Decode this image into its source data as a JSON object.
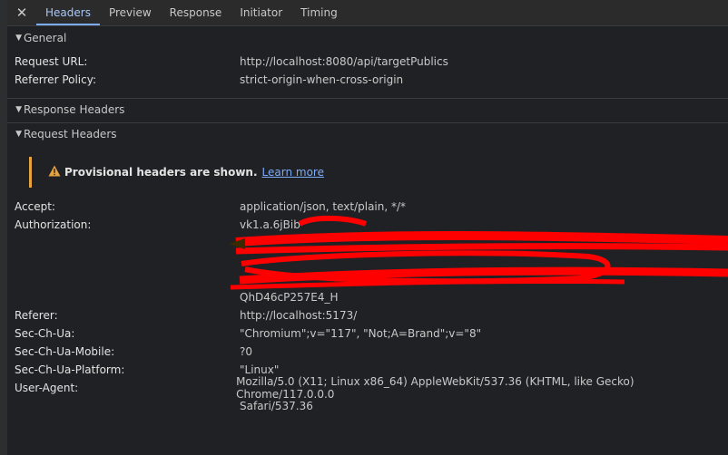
{
  "tabs": [
    "Headers",
    "Preview",
    "Response",
    "Initiator",
    "Timing"
  ],
  "sections": {
    "general": "General",
    "response_headers": "Response Headers",
    "request_headers": "Request Headers"
  },
  "general": {
    "request_url_key": "Request URL:",
    "request_url_val": "http://localhost:8080/api/targetPublics",
    "referrer_policy_key": "Referrer Policy:",
    "referrer_policy_val": "strict-origin-when-cross-origin"
  },
  "warning": {
    "text": "Provisional headers are shown.",
    "link": "Learn more"
  },
  "request": {
    "accept_key": "Accept:",
    "accept_val": "application/json, text/plain, */*",
    "auth_key": "Authorization:",
    "auth_lines": [
      "vk1.a.6jBib",
      "",
      "",
      "",
      "QhD46cP257E4_H"
    ],
    "referer_key": "Referer:",
    "referer_val": "http://localhost:5173/",
    "sec_ch_ua_key": "Sec-Ch-Ua:",
    "sec_ch_ua_val": "\"Chromium\";v=\"117\", \"Not;A=Brand\";v=\"8\"",
    "sec_ch_ua_mobile_key": "Sec-Ch-Ua-Mobile:",
    "sec_ch_ua_mobile_val": "?0",
    "sec_ch_ua_platform_key": "Sec-Ch-Ua-Platform:",
    "sec_ch_ua_platform_val": "\"Linux\"",
    "user_agent_key": "User-Agent:",
    "user_agent_line1": "Mozilla/5.0 (X11; Linux x86_64) AppleWebKit/537.36 (KHTML, like Gecko) Chrome/117.0.0.0",
    "user_agent_line2": "Safari/537.36"
  },
  "colors": {
    "accent": "#7cacf8",
    "warning": "#e7a33e",
    "redaction": "#ff0000"
  }
}
